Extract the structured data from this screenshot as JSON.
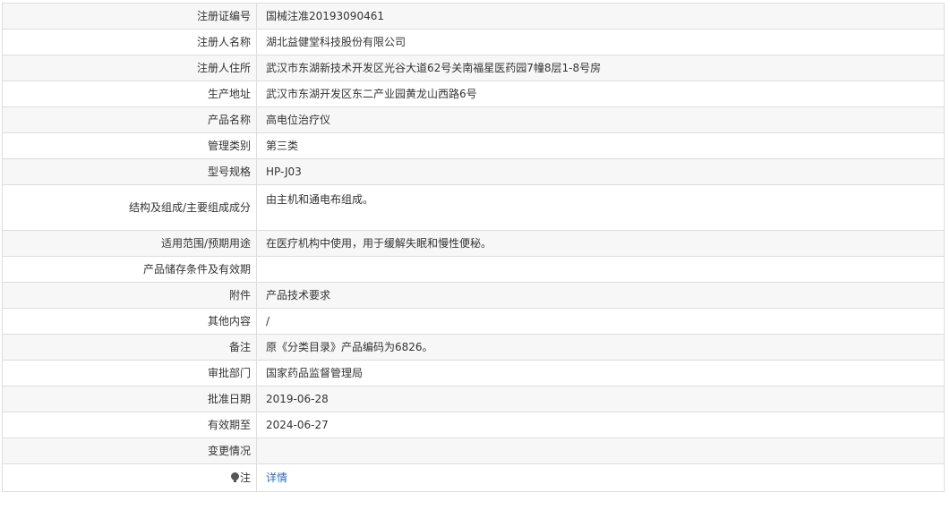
{
  "rows": [
    {
      "label": "注册证编号",
      "value": "国械注准20193090461"
    },
    {
      "label": "注册人名称",
      "value": "湖北益健堂科技股份有限公司"
    },
    {
      "label": "注册人住所",
      "value": "武汉市东湖新技术开发区光谷大道62号关南福星医药园7幢8层1-8号房"
    },
    {
      "label": "生产地址",
      "value": "武汉市东湖开发区东二产业园黄龙山西路6号"
    },
    {
      "label": "产品名称",
      "value": "高电位治疗仪"
    },
    {
      "label": "管理类别",
      "value": "第三类"
    },
    {
      "label": "型号规格",
      "value": "HP-J03"
    },
    {
      "label": "结构及组成/主要组成成分",
      "value": "由主机和通电布组成。"
    },
    {
      "label": "适用范围/预期用途",
      "value": "在医疗机构中使用，用于缓解失眠和慢性便秘。"
    },
    {
      "label": "产品储存条件及有效期",
      "value": ""
    },
    {
      "label": "附件",
      "value": "产品技术要求"
    },
    {
      "label": "其他内容",
      "value": "/"
    },
    {
      "label": "备注",
      "value": "原《分类目录》产品编码为6826。"
    },
    {
      "label": "审批部门",
      "value": "国家药品监督管理局"
    },
    {
      "label": "批准日期",
      "value": "2019-06-28"
    },
    {
      "label": "有效期至",
      "value": "2024-06-27"
    },
    {
      "label": "变更情况",
      "value": ""
    }
  ],
  "note_row": {
    "label": "注",
    "icon": "lightbulb-icon",
    "link_text": "详情"
  },
  "colors": {
    "border": "#dddddd",
    "row_alt": "#f7f7f7",
    "text": "#333333",
    "link": "#2a6ebb"
  }
}
